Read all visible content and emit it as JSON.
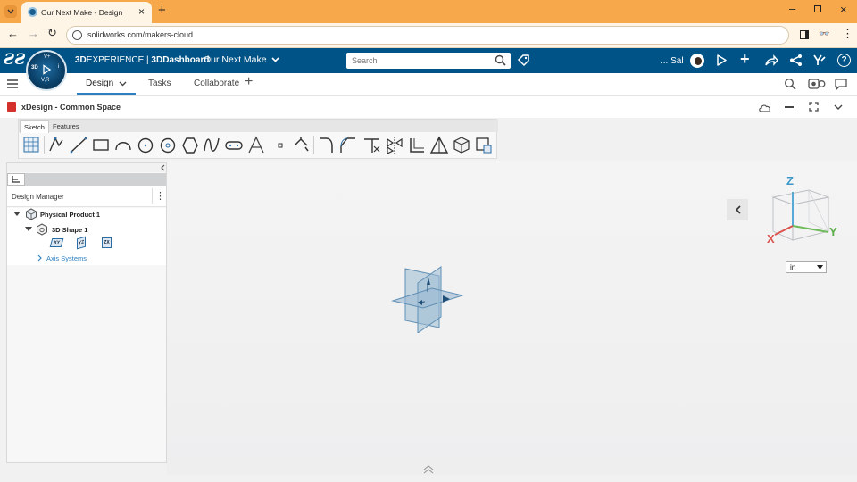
{
  "browser": {
    "tab_title": "Our Next Make - Design",
    "url": "solidworks.com/makers-cloud"
  },
  "header": {
    "brand_bold": "3D",
    "brand_rest": "EXPERIENCE | ",
    "dashboard_bold": "3D",
    "dashboard_rest": "Dashboard",
    "project": "Our Next Make",
    "search_placeholder": "Search",
    "user": "... Sal",
    "compass": {
      "top": "V+",
      "left": "3D",
      "right": "i",
      "bottom": "V,R"
    }
  },
  "tabs": [
    {
      "label": "Design",
      "active": true
    },
    {
      "label": "Tasks",
      "active": false
    },
    {
      "label": "Collaborate",
      "active": false
    }
  ],
  "app": {
    "title": "xDesign - Common Space"
  },
  "toolbar": {
    "tabs": [
      "Sketch",
      "Features"
    ],
    "tools": [
      "grid-sketch",
      "smart-dimension",
      "line",
      "rectangle",
      "arc",
      "circle",
      "circle-center",
      "polygon",
      "spline",
      "slot",
      "text",
      "point",
      "pen",
      "fillet",
      "chamfer",
      "trim",
      "mirror",
      "offset",
      "construction",
      "boss",
      "convert"
    ]
  },
  "design_manager": {
    "title": "Design Manager",
    "tree": [
      {
        "label": "Physical Product 1",
        "level": 0
      },
      {
        "label": "3D Shape 1",
        "level": 1
      }
    ],
    "planes": [
      "XY",
      "YZ",
      "ZX"
    ],
    "axis_systems": "Axis Systems"
  },
  "viewcube": {
    "x": "X",
    "y": "Y",
    "z": "Z",
    "unit": "in"
  },
  "colors": {
    "tab_strip": "#f6a84a",
    "app_bar": "#005386",
    "accent": "#2c7fc1"
  }
}
